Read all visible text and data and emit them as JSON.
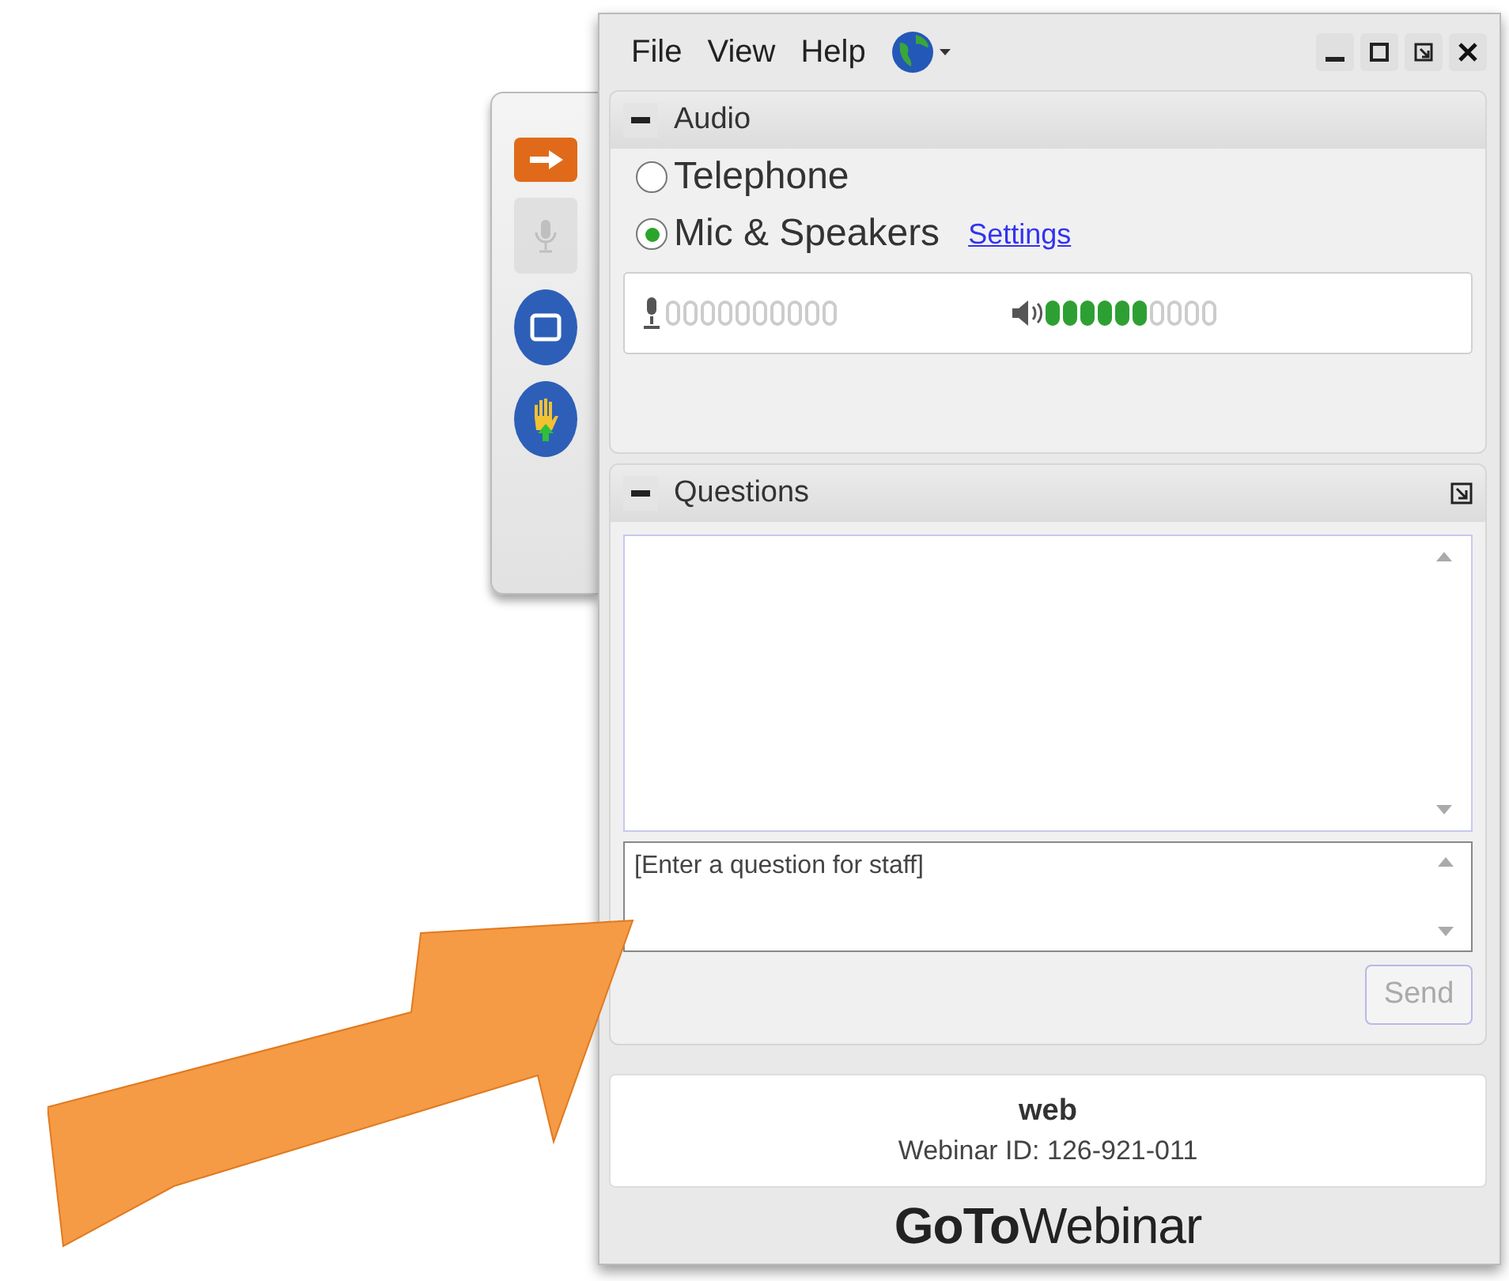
{
  "menu": [
    {
      "label": "File"
    },
    {
      "label": "View"
    },
    {
      "label": "Help"
    }
  ],
  "toolbar": [
    {
      "kind": "arrow",
      "disabled": false
    },
    {
      "kind": "mic",
      "disabled": true
    },
    {
      "kind": "screen",
      "disabled": false
    },
    {
      "kind": "hand",
      "disabled": false
    }
  ],
  "audio": {
    "title": "Audio",
    "options": [
      {
        "label": "Telephone",
        "selected": false
      },
      {
        "label": "Mic & Speakers",
        "selected": true
      }
    ],
    "settings_link": "Settings",
    "mic_meter": {
      "kind": "empty"
    },
    "speaker_meter": {
      "level": 0.6
    }
  },
  "questions": {
    "title": "Questions",
    "input": {
      "placeholder": "[Enter a question for staff]"
    },
    "send_button": {
      "label": "Send",
      "disabled": true
    }
  },
  "info": {
    "name": "web",
    "webinar_id": "Webinar ID: 126-921-011"
  },
  "logo": "**GoTo**Webinar"
}
